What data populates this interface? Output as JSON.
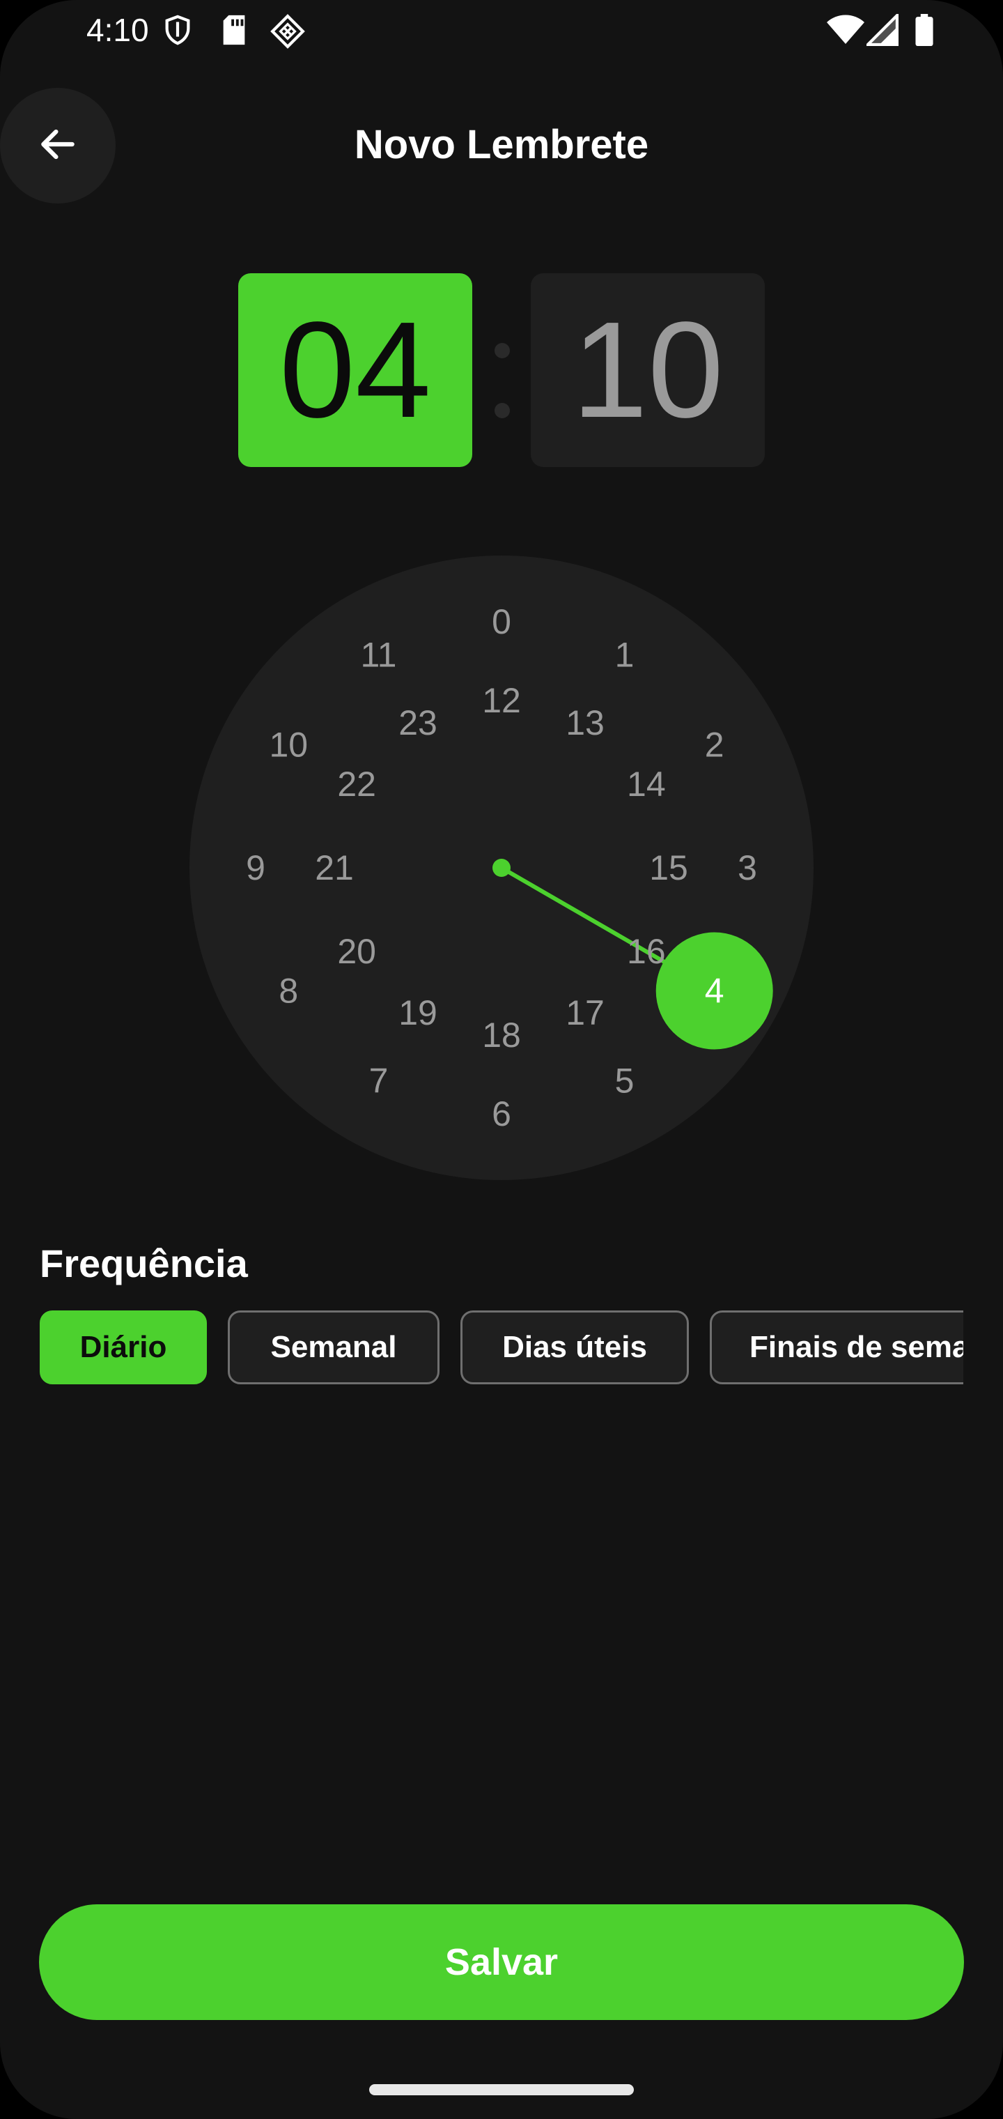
{
  "status_bar": {
    "time": "4:10",
    "icons": [
      "shield-icon",
      "sd-card-icon",
      "diamond-grid-icon",
      "wifi-icon",
      "cell-signal-icon",
      "battery-icon"
    ]
  },
  "header": {
    "title": "Novo Lembrete",
    "back_icon": "arrow-left-icon"
  },
  "time_picker": {
    "hours": "04",
    "minutes": "10",
    "selected_field": "hours"
  },
  "clock": {
    "outer_numbers": [
      "0",
      "1",
      "2",
      "3",
      "4",
      "5",
      "6",
      "7",
      "8",
      "9",
      "10",
      "11"
    ],
    "inner_numbers": [
      "12",
      "13",
      "14",
      "15",
      "16",
      "17",
      "18",
      "19",
      "20",
      "21",
      "22",
      "23"
    ],
    "selected": "4",
    "accent_color": "#4cd12e"
  },
  "frequency": {
    "label": "Frequência",
    "options": [
      "Diário",
      "Semanal",
      "Dias úteis",
      "Finais de semana"
    ],
    "selected": "Diário"
  },
  "actions": {
    "save_label": "Salvar"
  },
  "colors": {
    "background": "#131313",
    "surface": "#1f1f1f",
    "accent": "#4cd12e",
    "muted_text": "#9a9a9a"
  }
}
